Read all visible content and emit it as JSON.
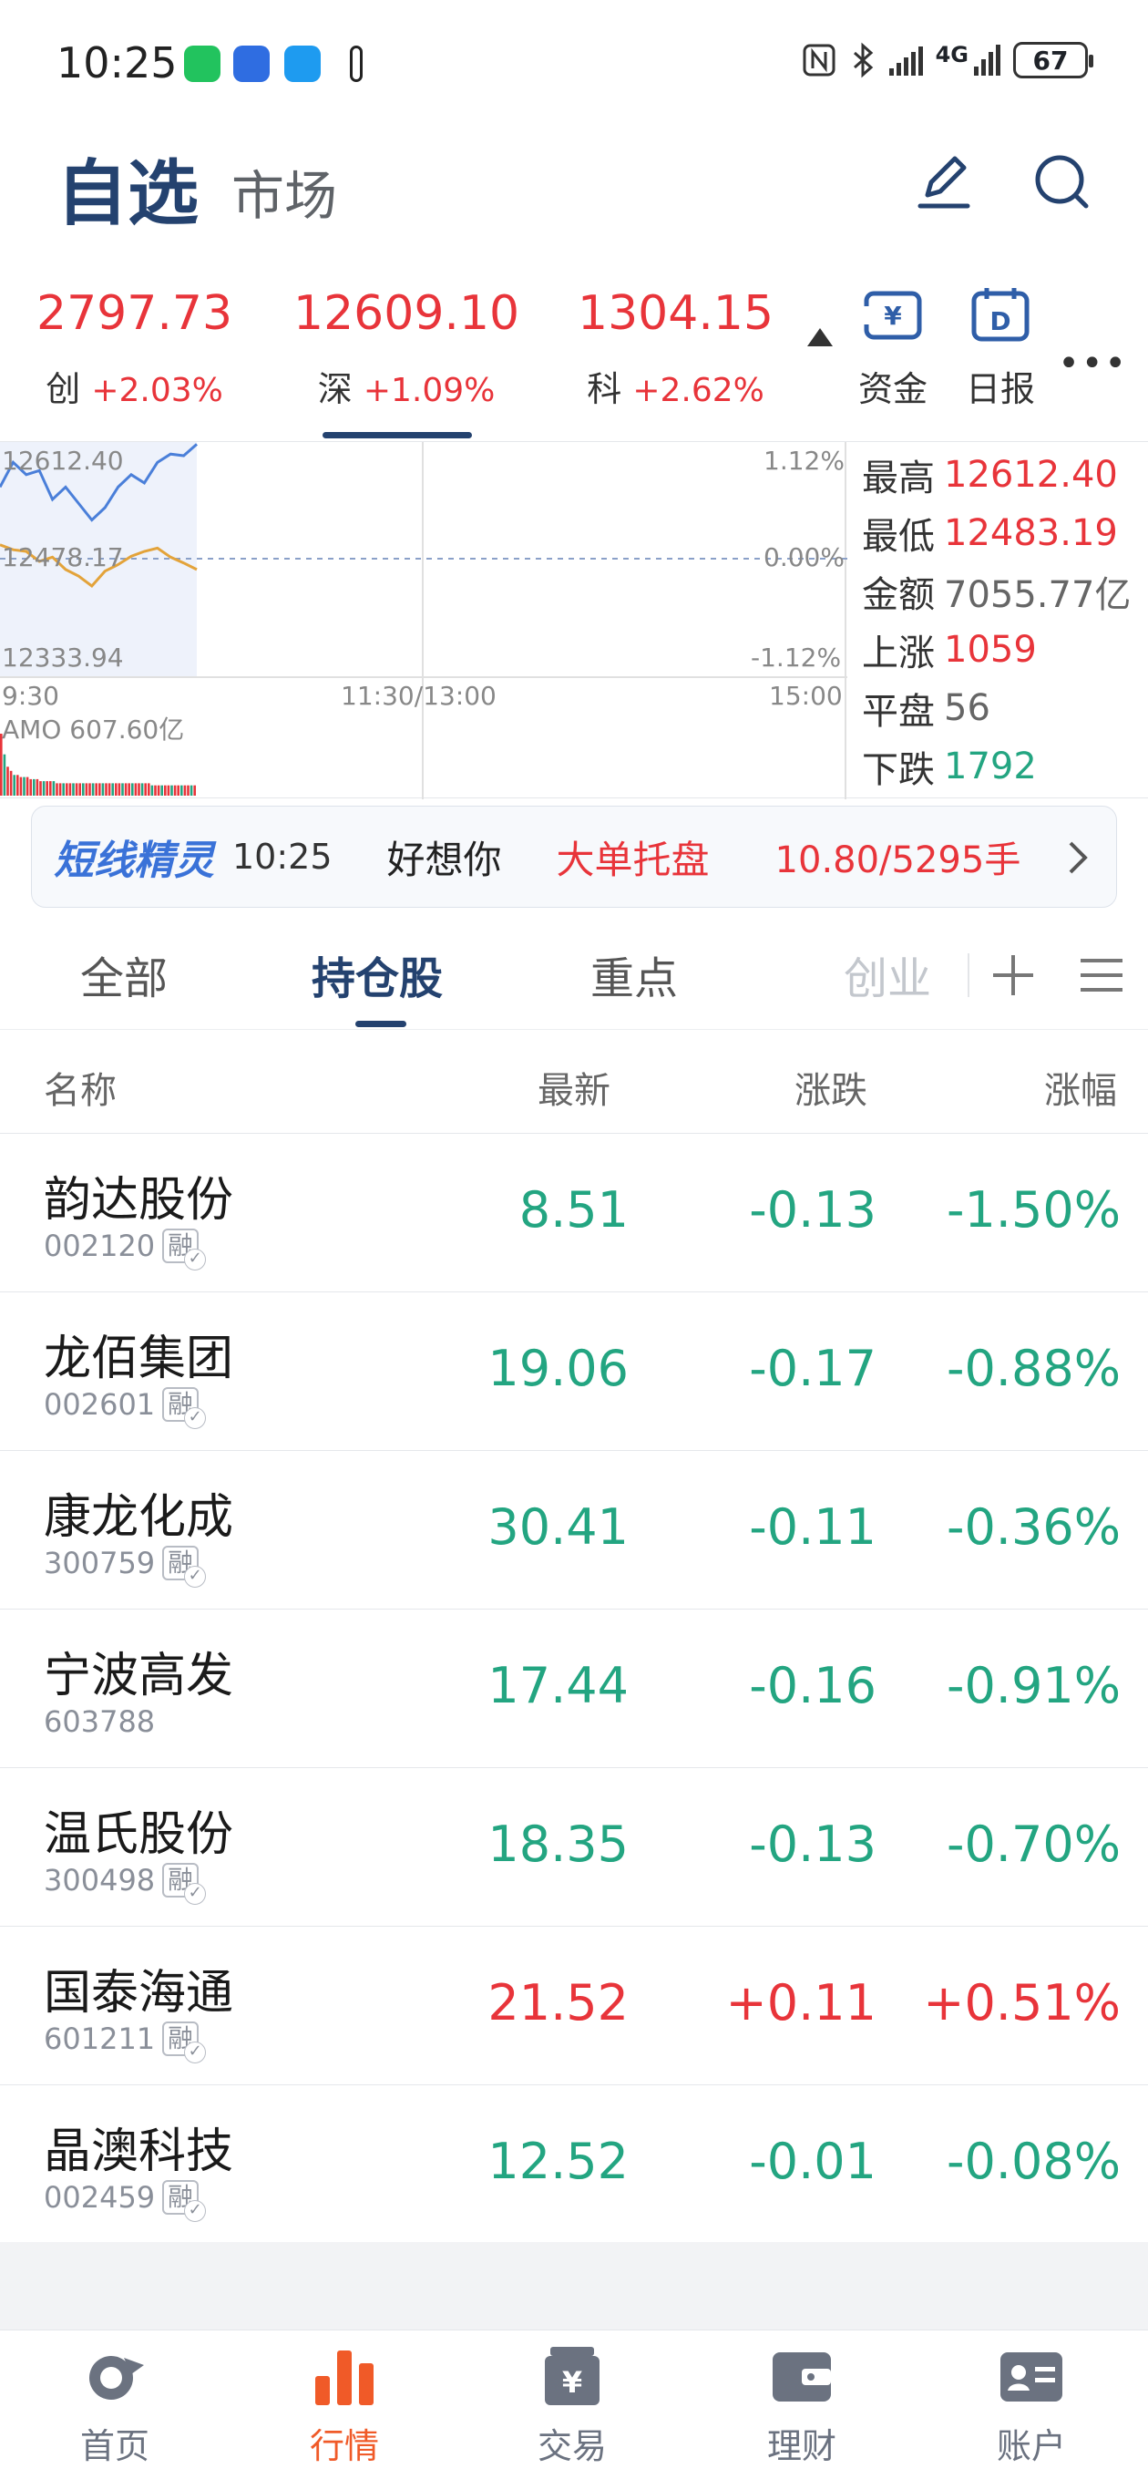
{
  "status_bar": {
    "time": "10:25",
    "network": "4G",
    "battery": "67",
    "icons": [
      "wechat-icon",
      "app-icon",
      "message-icon",
      "nfc-icon",
      "bluetooth-icon",
      "signal-icon"
    ]
  },
  "header": {
    "title": "自选",
    "subtitle": "市场",
    "icons": [
      "edit-icon",
      "search-icon"
    ]
  },
  "indices": [
    {
      "value": "2797.73",
      "name": "创",
      "change": "+2.03%"
    },
    {
      "value": "12609.10",
      "name": "深",
      "change": "+1.09%"
    },
    {
      "value": "1304.15",
      "name": "科",
      "change": "+2.62%"
    }
  ],
  "side_buttons": [
    {
      "label": "资金",
      "icon": "fund-icon"
    },
    {
      "label": "日报",
      "icon": "daily-report-icon"
    }
  ],
  "chart": {
    "high_label": "12612.40",
    "mid_label": "12478.17",
    "low_label": "12333.94",
    "pct_high": "1.12%",
    "pct_mid": "0.00%",
    "pct_low": "-1.12%",
    "time_start": "9:30",
    "time_mid": "11:30/13:00",
    "time_end": "15:00",
    "amo": "AMO 607.60亿"
  },
  "chart_data": {
    "type": "line",
    "series": [
      {
        "name": "",
        "color": "#4a7fd9",
        "values": [
          12560,
          12590,
          12575,
          12580,
          12545,
          12560,
          12540,
          12520,
          12535,
          12560,
          12575,
          12565,
          12590,
          12600,
          12598,
          12612
        ]
      },
      {
        "name": "",
        "color": "#e3a33a",
        "values": [
          12490,
          12484,
          12482,
          12470,
          12475,
          12460,
          12452,
          12440,
          12458,
          12466,
          12476,
          12482,
          12486,
          12475,
          12468,
          12460
        ]
      }
    ],
    "ylim": [
      12333.94,
      12612.4
    ],
    "volume": [
      30,
      20,
      14,
      12,
      10,
      10,
      9,
      9,
      9,
      8,
      8,
      8,
      7,
      7,
      7,
      7,
      7,
      6,
      6,
      6,
      6,
      6,
      6,
      6,
      6,
      6,
      6,
      6,
      6,
      6,
      6,
      6,
      6,
      6,
      6,
      6,
      6,
      6,
      6,
      6,
      6,
      6,
      6,
      6,
      6,
      6,
      5,
      5,
      5,
      5,
      5,
      5,
      5,
      5,
      5,
      5,
      5,
      5,
      5,
      5
    ]
  },
  "stats": {
    "high_label": "最高",
    "high_value": "12612.40",
    "low_label": "最低",
    "low_value": "12483.19",
    "amount_label": "金额",
    "amount_value": "7055.77亿",
    "rise_label": "上涨",
    "rise_value": "1059",
    "flat_label": "平盘",
    "flat_value": "56",
    "fall_label": "下跌",
    "fall_value": "1792"
  },
  "ticker": {
    "brand": "短线精灵",
    "time": "10:25",
    "name": "好想你",
    "event": "大单托盘",
    "detail": "10.80/5295手"
  },
  "tabs": [
    "全部",
    "持仓股",
    "重点",
    "创业"
  ],
  "table": {
    "headers": [
      "名称",
      "最新",
      "涨跌",
      "涨幅"
    ],
    "margin_badge": "融",
    "rows": [
      {
        "name": "韵达股份",
        "code": "002120",
        "margin": true,
        "price": "8.51",
        "change": "-0.13",
        "pct": "-1.50%",
        "dir": "down"
      },
      {
        "name": "龙佰集团",
        "code": "002601",
        "margin": true,
        "price": "19.06",
        "change": "-0.17",
        "pct": "-0.88%",
        "dir": "down"
      },
      {
        "name": "康龙化成",
        "code": "300759",
        "margin": true,
        "price": "30.41",
        "change": "-0.11",
        "pct": "-0.36%",
        "dir": "down"
      },
      {
        "name": "宁波高发",
        "code": "603788",
        "margin": false,
        "price": "17.44",
        "change": "-0.16",
        "pct": "-0.91%",
        "dir": "down"
      },
      {
        "name": "温氏股份",
        "code": "300498",
        "margin": true,
        "price": "18.35",
        "change": "-0.13",
        "pct": "-0.70%",
        "dir": "down"
      },
      {
        "name": "国泰海通",
        "code": "601211",
        "margin": true,
        "price": "21.52",
        "change": "+0.11",
        "pct": "+0.51%",
        "dir": "up"
      },
      {
        "name": "晶澳科技",
        "code": "002459",
        "margin": true,
        "price": "12.52",
        "change": "-0.01",
        "pct": "-0.08%",
        "dir": "down"
      }
    ]
  },
  "bottom_nav": [
    {
      "label": "首页",
      "icon": "home-icon"
    },
    {
      "label": "行情",
      "icon": "market-icon",
      "active": true
    },
    {
      "label": "交易",
      "icon": "trade-icon"
    },
    {
      "label": "理财",
      "icon": "wallet-icon"
    },
    {
      "label": "账户",
      "icon": "account-icon"
    }
  ],
  "colors": {
    "up": "#e8343a",
    "down": "#23a581",
    "brand": "#24426f",
    "nav_active": "#f05a28"
  }
}
